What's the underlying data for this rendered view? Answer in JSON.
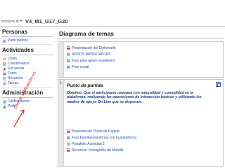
{
  "breadcrumb": {
    "site": "DGGEPN.IP",
    "separator": "►",
    "course": "V4_M1_G17_G20"
  },
  "sidebar": {
    "personas": {
      "title": "Personas",
      "items": [
        {
          "label": "Participantes",
          "icon": "users-icon"
        }
      ]
    },
    "actividades": {
      "title": "Actividades",
      "items": [
        {
          "label": "Chats",
          "icon": "chat-icon"
        },
        {
          "label": "Cuestionarios",
          "icon": "quiz-icon"
        },
        {
          "label": "Encuestas",
          "icon": "survey-icon"
        },
        {
          "label": "Foros",
          "icon": "forum-icon"
        },
        {
          "label": "Recursos",
          "icon": "resource-icon"
        },
        {
          "label": "Tareas",
          "icon": "assignment-icon"
        }
      ]
    },
    "administracion": {
      "title": "Administración",
      "items": [
        {
          "label": "Calificaciones",
          "icon": "grades-icon"
        },
        {
          "label": "Perfil",
          "icon": "profile-icon"
        }
      ]
    }
  },
  "main": {
    "title": "Diagrama de temas",
    "section0": {
      "resources": [
        {
          "label": "Presentación del Diplomado",
          "icon": "pdf-icon"
        },
        {
          "label": "AVISOS IMPORTANTES",
          "icon": "forum-icon"
        },
        {
          "label": "Foro para apoyo académico",
          "icon": "forum-icon"
        },
        {
          "label": "Foro social",
          "icon": "forum-icon"
        }
      ]
    },
    "section1": {
      "number": "1",
      "title": "Punto de partida",
      "objective": "Objetivo: Que el participante navegue con naturalidad y comodidad en la plataforma, realizando las operaciones de interacción básicas y utilizando los medios de apoyo On Line que se disponen.",
      "resources": [
        {
          "label": "Presentación Punto de Partida",
          "icon": "pdf-icon"
        },
        {
          "label": "Foro Familiarizándonos con la plataforma",
          "icon": "forum-icon"
        },
        {
          "label": "Portafolio Actividad 2",
          "icon": "assignment-icon"
        },
        {
          "label": "Recursos: Iconografía de Moodle",
          "icon": "pdf-icon"
        }
      ]
    }
  },
  "annotation": {
    "text": "Checar calificación es",
    "color": "#e02020"
  },
  "colors": {
    "link": "#1f4fa5",
    "objective": "#1a3d8a",
    "rule": "#bdbdbd"
  }
}
